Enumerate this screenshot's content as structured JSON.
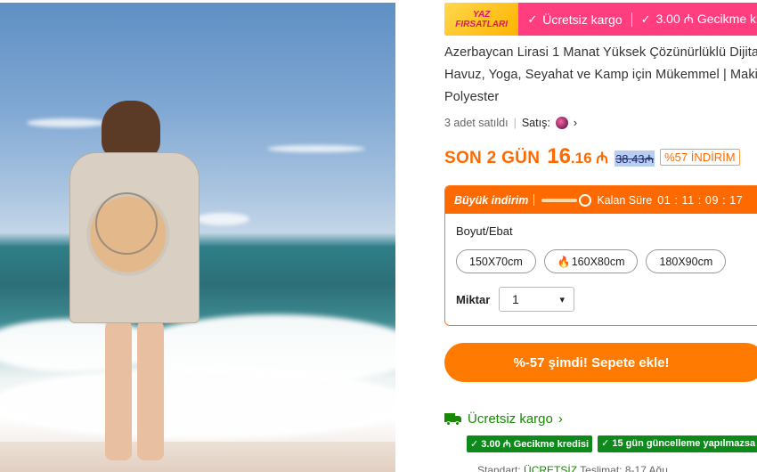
{
  "banner": {
    "logo_line1": "YAZ",
    "logo_line2": "FIRSATLARI",
    "item1": "Ücretsiz kargo",
    "item2": "3.00 ₼ Gecikme k"
  },
  "product": {
    "title_line1": "Azerbaycan Lirasi 1 Manat Yüksek Çözünürlüklü Dijita",
    "title_line2": "Havuz, Yoga, Seyahat ve Kamp için Mükemmel | Maki",
    "title_line3": "Polyester",
    "sold": "3 adet satıldı",
    "seller_label": "Satış:"
  },
  "price": {
    "prefix": "SON 2 GÜN",
    "integer": "16",
    "decimal": ".16 ₼",
    "old": "38.43₼",
    "discount": "%57 İNDİRİM"
  },
  "deal": {
    "title": "Büyük indirim",
    "remaining_label": "Kalan Süre",
    "countdown": "01 : 11 : 09 : 17",
    "size_label": "Boyut/Ebat",
    "sizes": [
      "150X70cm",
      "160X80cm",
      "180X90cm"
    ],
    "qty_label": "Miktar",
    "qty_value": "1"
  },
  "cta": {
    "label": "%-57 şimdi! Sepete ekle!"
  },
  "shipping": {
    "title": "Ücretsiz kargo",
    "tag1": "✓ 3.00 ₼ Gecikme kredisi",
    "tag2": "✓ 15 gün güncelleme yapılmazsa p",
    "standard_label": "Standart:",
    "standard_value": "ÜCRETSİZ",
    "delivery": "Teslimat: 8-17 Ağu"
  },
  "colors": {
    "accent": "#ff6a00",
    "pink": "#ff3d7f",
    "green": "#178a00"
  }
}
